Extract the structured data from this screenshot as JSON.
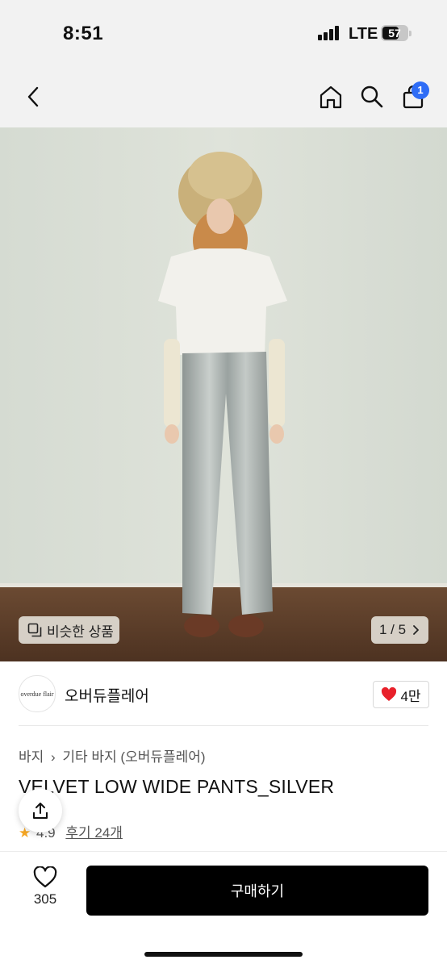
{
  "status_bar": {
    "time": "8:51",
    "network": "LTE",
    "battery": "57"
  },
  "nav": {
    "cart_count": "1"
  },
  "gallery": {
    "similar_label": "비슷한 상품",
    "page_indicator": "1 / 5"
  },
  "brand": {
    "logo_text": "overdue flair",
    "name": "오버듀플레어",
    "likes": "4만"
  },
  "product": {
    "breadcrumb_1": "바지",
    "breadcrumb_2": "기타 바지 (오버듀플레어)",
    "title": "VELVET LOW WIDE PANTS_SILVER",
    "rating": "4.9",
    "review_label": "후기 24개"
  },
  "bottom_bar": {
    "wish_count": "305",
    "buy_label": "구매하기"
  },
  "colors": {
    "accent_badge": "#2f6df6",
    "heart": "#e8202a",
    "buy_button": "#000000",
    "star": "#f5a623"
  }
}
